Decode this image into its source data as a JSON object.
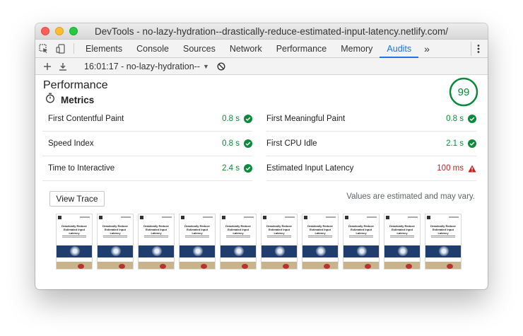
{
  "window": {
    "title": "DevTools - no-lazy-hydration--drastically-reduce-estimated-input-latency.netlify.com/"
  },
  "tabs": [
    {
      "label": "Elements"
    },
    {
      "label": "Console"
    },
    {
      "label": "Sources"
    },
    {
      "label": "Network"
    },
    {
      "label": "Performance"
    },
    {
      "label": "Memory"
    },
    {
      "label": "Audits",
      "active": true
    }
  ],
  "more_label": "»",
  "toolbar": {
    "session": "16:01:17 - no-lazy-hydration--"
  },
  "report": {
    "category_title": "Performance",
    "score": "99",
    "metrics_label": "Metrics",
    "metrics": [
      {
        "name": "First Contentful Paint",
        "value": "0.8 s",
        "status": "pass"
      },
      {
        "name": "First Meaningful Paint",
        "value": "0.8 s",
        "status": "pass"
      },
      {
        "name": "Speed Index",
        "value": "0.8 s",
        "status": "pass"
      },
      {
        "name": "First CPU Idle",
        "value": "2.1 s",
        "status": "pass"
      },
      {
        "name": "Time to Interactive",
        "value": "2.4 s",
        "status": "pass"
      },
      {
        "name": "Estimated Input Latency",
        "value": "100 ms",
        "status": "fail"
      }
    ],
    "view_trace_label": "View Trace",
    "note": "Values are estimated and may vary."
  },
  "filmstrip": {
    "frame_count": 10,
    "frame_text": "Drastically Reduce Estimated Input Latency"
  },
  "colors": {
    "pass": "#0c8a3b",
    "fail": "#c5221f",
    "accent": "#1a73e8"
  }
}
